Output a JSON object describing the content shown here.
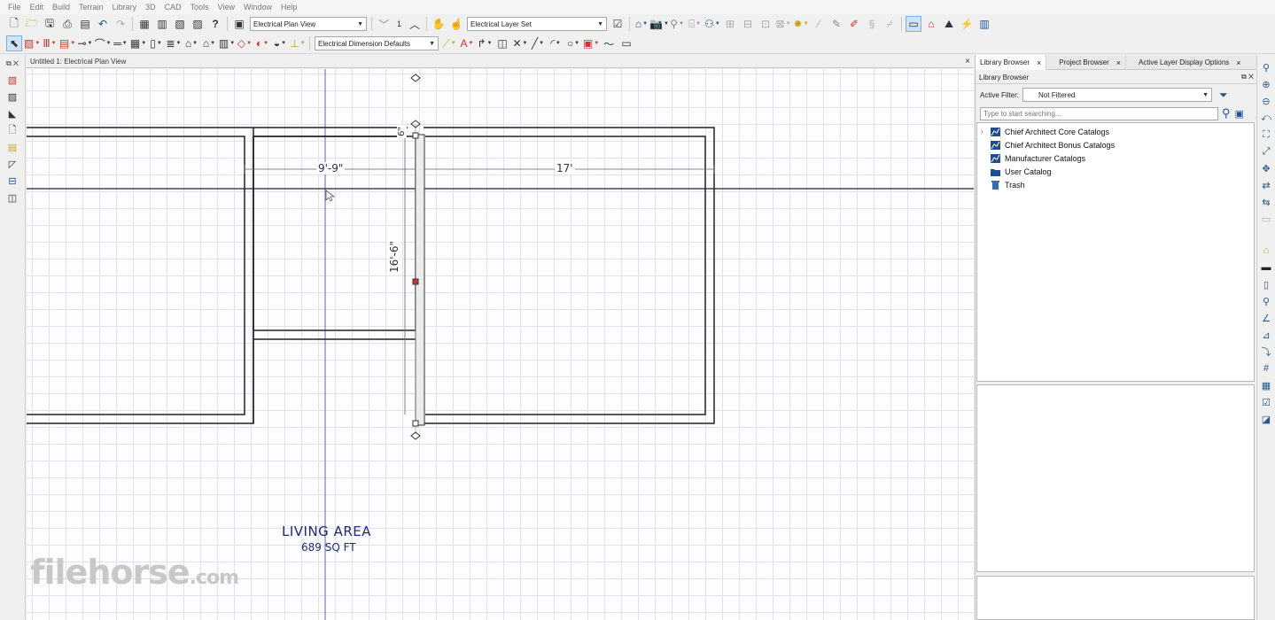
{
  "menu": [
    "File",
    "Edit",
    "Build",
    "Terrain",
    "Library",
    "3D",
    "CAD",
    "Tools",
    "View",
    "Window",
    "Help"
  ],
  "toolbar1": {
    "plan_view": "Electrical Plan View",
    "floor_number": "1",
    "layer_set": "Electrical Layer Set"
  },
  "toolbar2": {
    "dimension_defaults": "Electrical Dimension Defaults"
  },
  "view_tab": {
    "title": "Untitled 1: Electrical Plan View",
    "close": "×"
  },
  "drawing": {
    "dimensions": [
      {
        "id": "dim-9-9",
        "text": "9'-9\""
      },
      {
        "id": "dim-17",
        "text": "17'"
      },
      {
        "id": "dim-16-6",
        "text": "16'-6\""
      },
      {
        "id": "dim-6",
        "text": "6\""
      }
    ],
    "room_name": "LIVING AREA",
    "room_area": "689 SQ FT",
    "watermark": "filehorse",
    "watermark_domain": ".com",
    "colors": {
      "wall": "#222222",
      "room_label": "#1f2d6b",
      "guide_line": "#6a5acd",
      "grid": "#dfe0f0",
      "handle_active": "#cc3333"
    }
  },
  "right_panel": {
    "tabs": [
      {
        "label": "Library Browser",
        "close": "×",
        "active": true
      },
      {
        "label": "Project Browser",
        "close": "×",
        "active": false
      },
      {
        "label": "Active Layer Display Options",
        "close": "×",
        "active": false
      }
    ],
    "header": "Library Browser",
    "filter_label": "Active Filter:",
    "filter_value": "Not Filtered",
    "search_placeholder": "Type to start searching...",
    "tree": [
      {
        "label": "Chief Architect Core Catalogs",
        "icon": "catalog-icon",
        "expandable": true
      },
      {
        "label": "Chief Architect Bonus Catalogs",
        "icon": "catalog-icon",
        "expandable": false
      },
      {
        "label": "Manufacturer Catalogs",
        "icon": "catalog-icon",
        "expandable": false
      },
      {
        "label": "User Catalog",
        "icon": "folder-icon",
        "expandable": false
      },
      {
        "label": "Trash",
        "icon": "trash-icon",
        "expandable": false
      }
    ]
  }
}
